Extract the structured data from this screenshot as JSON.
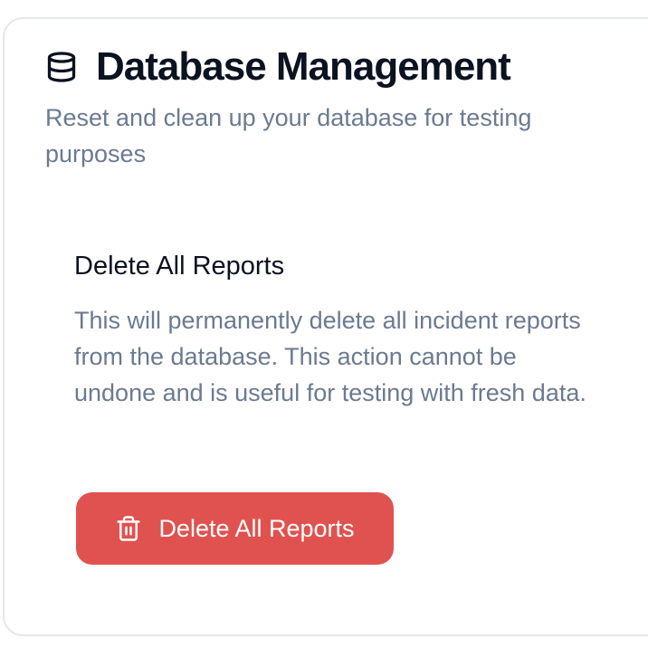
{
  "card": {
    "title": "Database Management",
    "title_icon": "database-icon",
    "subtitle": "Reset and clean up your database for testing purposes"
  },
  "delete_section": {
    "title": "Delete All Reports",
    "description": "This will permanently delete all incident reports from the database. This action cannot be undone and is useful for testing with fresh data.",
    "button_label": "Delete All Reports",
    "button_icon": "trash-icon"
  },
  "colors": {
    "danger": "#e0524f",
    "title_text": "#0b1220",
    "muted_text": "#6b7a90",
    "card_border": "#e5e7eb"
  }
}
